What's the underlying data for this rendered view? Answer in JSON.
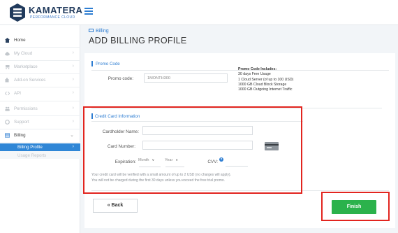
{
  "brand": {
    "name": "KAMATERA",
    "tagline": "PERFORMANCE CLOUD",
    "accent": "#2d7dd2"
  },
  "sidebar": {
    "items": [
      {
        "label": "Home",
        "icon": "home-icon"
      },
      {
        "label": "My Cloud",
        "icon": "cloud-icon"
      },
      {
        "label": "Marketplace",
        "icon": "cart-icon"
      },
      {
        "label": "Add-on Services",
        "icon": "puzzle-icon"
      },
      {
        "label": "API",
        "icon": "code-icon"
      },
      {
        "label": "Permissions",
        "icon": "users-icon"
      },
      {
        "label": "Support",
        "icon": "support-icon"
      },
      {
        "label": "Billing",
        "icon": "card-icon"
      }
    ],
    "subitems": [
      {
        "label": "Billing Profile"
      },
      {
        "label": "Usage Reports"
      }
    ]
  },
  "header": {
    "breadcrumb": "Billing",
    "title": "ADD BILLING PROFILE"
  },
  "promo": {
    "section_title": "Promo Code",
    "label": "Promo code:",
    "value": "1MONTH300",
    "note_title": "Promo Code Includes:",
    "note_lines": [
      "30 days Free Usage",
      "1 Cloud Server (of up to 100 USD)",
      "1000 GB Cloud Block Storage",
      "1000 GB Outgoing Internet Traffic"
    ]
  },
  "card": {
    "section_title": "Credit Card Information",
    "cardholder_label": "Cardholder Name:",
    "number_label": "Card Number:",
    "expiration_label": "Expiration:",
    "month_value": "Month",
    "year_value": "Year",
    "cvv_label": "CVV:",
    "help_glyph": "?",
    "note_line1": "Your credit card will be verified with a small amount of up to 2 USD (no charges will apply).",
    "note_line2": "You will not be charged during the first 30 days unless you exceed the free trial promo."
  },
  "actions": {
    "back_label": "« Back",
    "finish_label": "Finish"
  },
  "colors": {
    "highlight": "#e2251f",
    "finish": "#2bb24c",
    "selected_nav": "#2f86d6"
  }
}
